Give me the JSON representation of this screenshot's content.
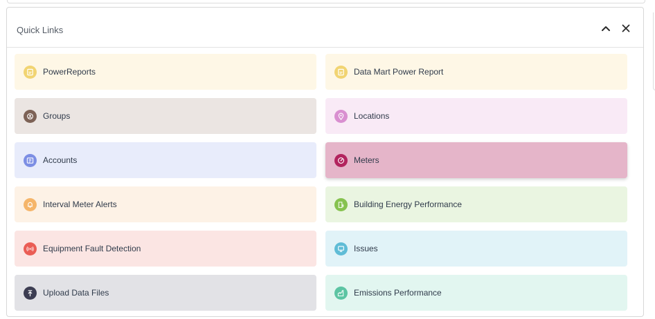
{
  "panel": {
    "title": "Quick Links"
  },
  "links": [
    {
      "label": "PowerReports",
      "icon": "report-icon",
      "bg": "#fef7e6",
      "icon_bg": "#f1d472"
    },
    {
      "label": "Data Mart Power Report",
      "icon": "report-icon",
      "bg": "#fef7e6",
      "icon_bg": "#f1d472"
    },
    {
      "label": "Groups",
      "icon": "groups-icon",
      "bg": "#ebe5e2",
      "icon_bg": "#7d6256"
    },
    {
      "label": "Locations",
      "icon": "location-pin-icon",
      "bg": "#f9eaf6",
      "icon_bg": "#d98fd0"
    },
    {
      "label": "Accounts",
      "icon": "accounts-icon",
      "bg": "#e8ecfb",
      "icon_bg": "#7c8ee4"
    },
    {
      "label": "Meters",
      "icon": "gauge-icon",
      "bg": "#e5b5c9",
      "icon_bg": "#b2245e",
      "active": true
    },
    {
      "label": "Interval Meter Alerts",
      "icon": "bell-icon",
      "bg": "#fdf2e6",
      "icon_bg": "#f5b56a"
    },
    {
      "label": "Building Energy Performance",
      "icon": "building-energy-icon",
      "bg": "#eaf5e1",
      "icon_bg": "#86c24f"
    },
    {
      "label": "Equipment Fault Detection",
      "icon": "signal-alert-icon",
      "bg": "#fbe5e3",
      "icon_bg": "#ea5d55"
    },
    {
      "label": "Issues",
      "icon": "monitor-icon",
      "bg": "#e1f3f8",
      "icon_bg": "#5fbcd6"
    },
    {
      "label": "Upload Data Files",
      "icon": "upload-icon",
      "bg": "#e2e2e6",
      "icon_bg": "#3c3d52"
    },
    {
      "label": "Emissions Performance",
      "icon": "factory-icon",
      "bg": "#e2f6f0",
      "icon_bg": "#5cc4a3"
    }
  ]
}
